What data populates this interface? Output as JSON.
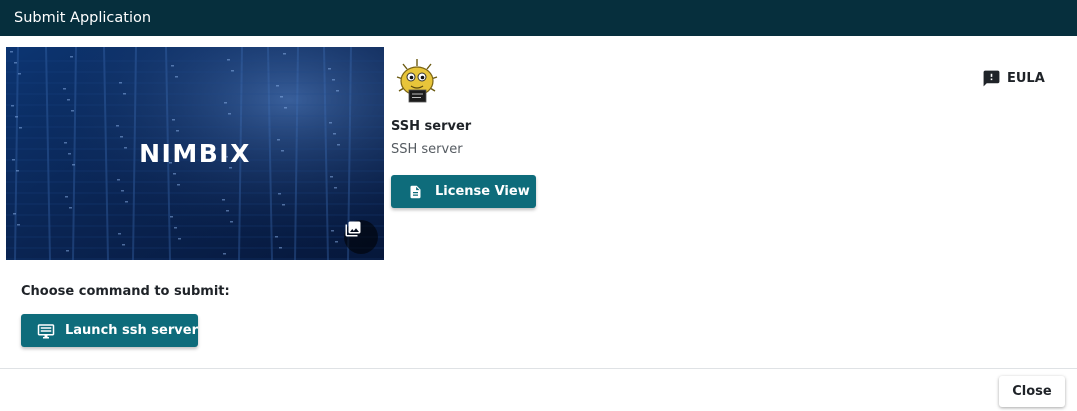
{
  "dialog": {
    "title": "Submit Application",
    "close_label": "Close"
  },
  "hero": {
    "brand_text": "NIMBIX",
    "gallery_icon": "photo-library-icon"
  },
  "app": {
    "icon": "pufferfish-icon",
    "name": "SSH server",
    "description": "SSH server",
    "license_button_label": "License View",
    "license_icon": "document-icon",
    "eula_label": "EULA",
    "eula_icon": "feedback-icon"
  },
  "commands": {
    "prompt": "Choose command to submit:",
    "items": [
      {
        "label": "Launch ssh server",
        "icon": "desktop-icon"
      }
    ]
  },
  "colors": {
    "header_bg": "#062f3d",
    "accent": "#0e6c7b"
  }
}
